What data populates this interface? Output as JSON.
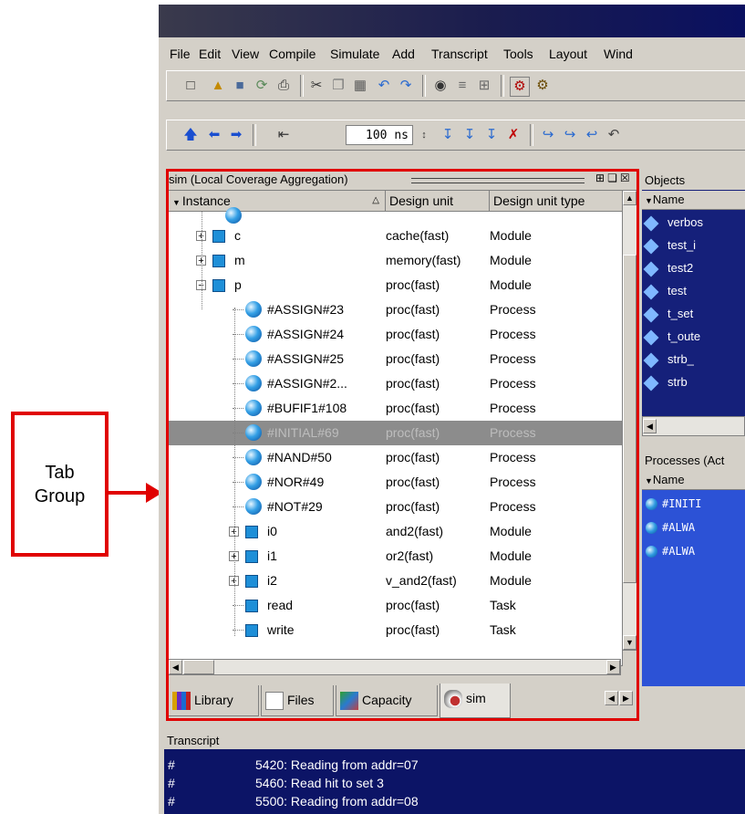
{
  "callout": {
    "line1": "Tab",
    "line2": "Group"
  },
  "menu": [
    "File",
    "Edit",
    "View",
    "Compile",
    "Simulate",
    "Add",
    "Transcript",
    "Tools",
    "Layout",
    "Wind"
  ],
  "toolbar2": {
    "time_value": "100 ns"
  },
  "sim_panel": {
    "title": "sim (Local Coverage Aggregation)",
    "columns": [
      "Instance",
      "Design unit",
      "Design unit type"
    ],
    "rows": [
      {
        "name": "c",
        "unit": "cache(fast)",
        "type": "Module",
        "icon": "module-icon",
        "depth": 1,
        "expander": "+"
      },
      {
        "name": "m",
        "unit": "memory(fast)",
        "type": "Module",
        "icon": "module-icon",
        "depth": 1,
        "expander": "+"
      },
      {
        "name": "p",
        "unit": "proc(fast)",
        "type": "Module",
        "icon": "module-icon",
        "depth": 1,
        "expander": "-"
      },
      {
        "name": "#ASSIGN#23",
        "unit": "proc(fast)",
        "type": "Process",
        "icon": "process-icon",
        "depth": 2
      },
      {
        "name": "#ASSIGN#24",
        "unit": "proc(fast)",
        "type": "Process",
        "icon": "process-icon",
        "depth": 2
      },
      {
        "name": "#ASSIGN#25",
        "unit": "proc(fast)",
        "type": "Process",
        "icon": "process-icon",
        "depth": 2
      },
      {
        "name": "#ASSIGN#2...",
        "unit": "proc(fast)",
        "type": "Process",
        "icon": "process-icon",
        "depth": 2
      },
      {
        "name": "#BUFIF1#108",
        "unit": "proc(fast)",
        "type": "Process",
        "icon": "process-icon",
        "depth": 2
      },
      {
        "name": "#INITIAL#69",
        "unit": "proc(fast)",
        "type": "Process",
        "icon": "process-icon",
        "depth": 2,
        "selected": true
      },
      {
        "name": "#NAND#50",
        "unit": "proc(fast)",
        "type": "Process",
        "icon": "process-icon",
        "depth": 2
      },
      {
        "name": "#NOR#49",
        "unit": "proc(fast)",
        "type": "Process",
        "icon": "process-icon",
        "depth": 2
      },
      {
        "name": "#NOT#29",
        "unit": "proc(fast)",
        "type": "Process",
        "icon": "process-icon",
        "depth": 2
      },
      {
        "name": "i0",
        "unit": "and2(fast)",
        "type": "Module",
        "icon": "module-icon",
        "depth": 2,
        "expander": "+"
      },
      {
        "name": "i1",
        "unit": "or2(fast)",
        "type": "Module",
        "icon": "module-icon",
        "depth": 2,
        "expander": "+"
      },
      {
        "name": "i2",
        "unit": "v_and2(fast)",
        "type": "Module",
        "icon": "module-icon",
        "depth": 2,
        "expander": "+"
      },
      {
        "name": "read",
        "unit": "proc(fast)",
        "type": "Task",
        "icon": "module-icon",
        "depth": 2
      },
      {
        "name": "write",
        "unit": "proc(fast)",
        "type": "Task",
        "icon": "module-icon",
        "depth": 2
      }
    ],
    "tabs": [
      "Library",
      "Files",
      "Capacity",
      "sim"
    ],
    "active_tab": "sim"
  },
  "objects_panel": {
    "title": "Objects",
    "column": "Name",
    "items": [
      "verbos",
      "test_i",
      "test2",
      "test",
      "t_set",
      "t_oute",
      "strb_",
      "strb"
    ]
  },
  "processes_panel": {
    "title": "Processes (Act",
    "column": "Name",
    "items": [
      "#INITI",
      "#ALWA",
      "#ALWA"
    ]
  },
  "transcript": {
    "title": "Transcript",
    "lines": [
      {
        "hash": "#",
        "text": "5420: Reading from addr=07"
      },
      {
        "hash": "#",
        "text": "5460: Read hit to set 3"
      },
      {
        "hash": "#",
        "text": "5500: Reading from addr=08"
      }
    ]
  },
  "colors": {
    "highlight_red": "#e00000",
    "selection_gray": "#8c8c8c",
    "objects_bg": "#15207a",
    "processes_bg": "#2c52d6"
  }
}
